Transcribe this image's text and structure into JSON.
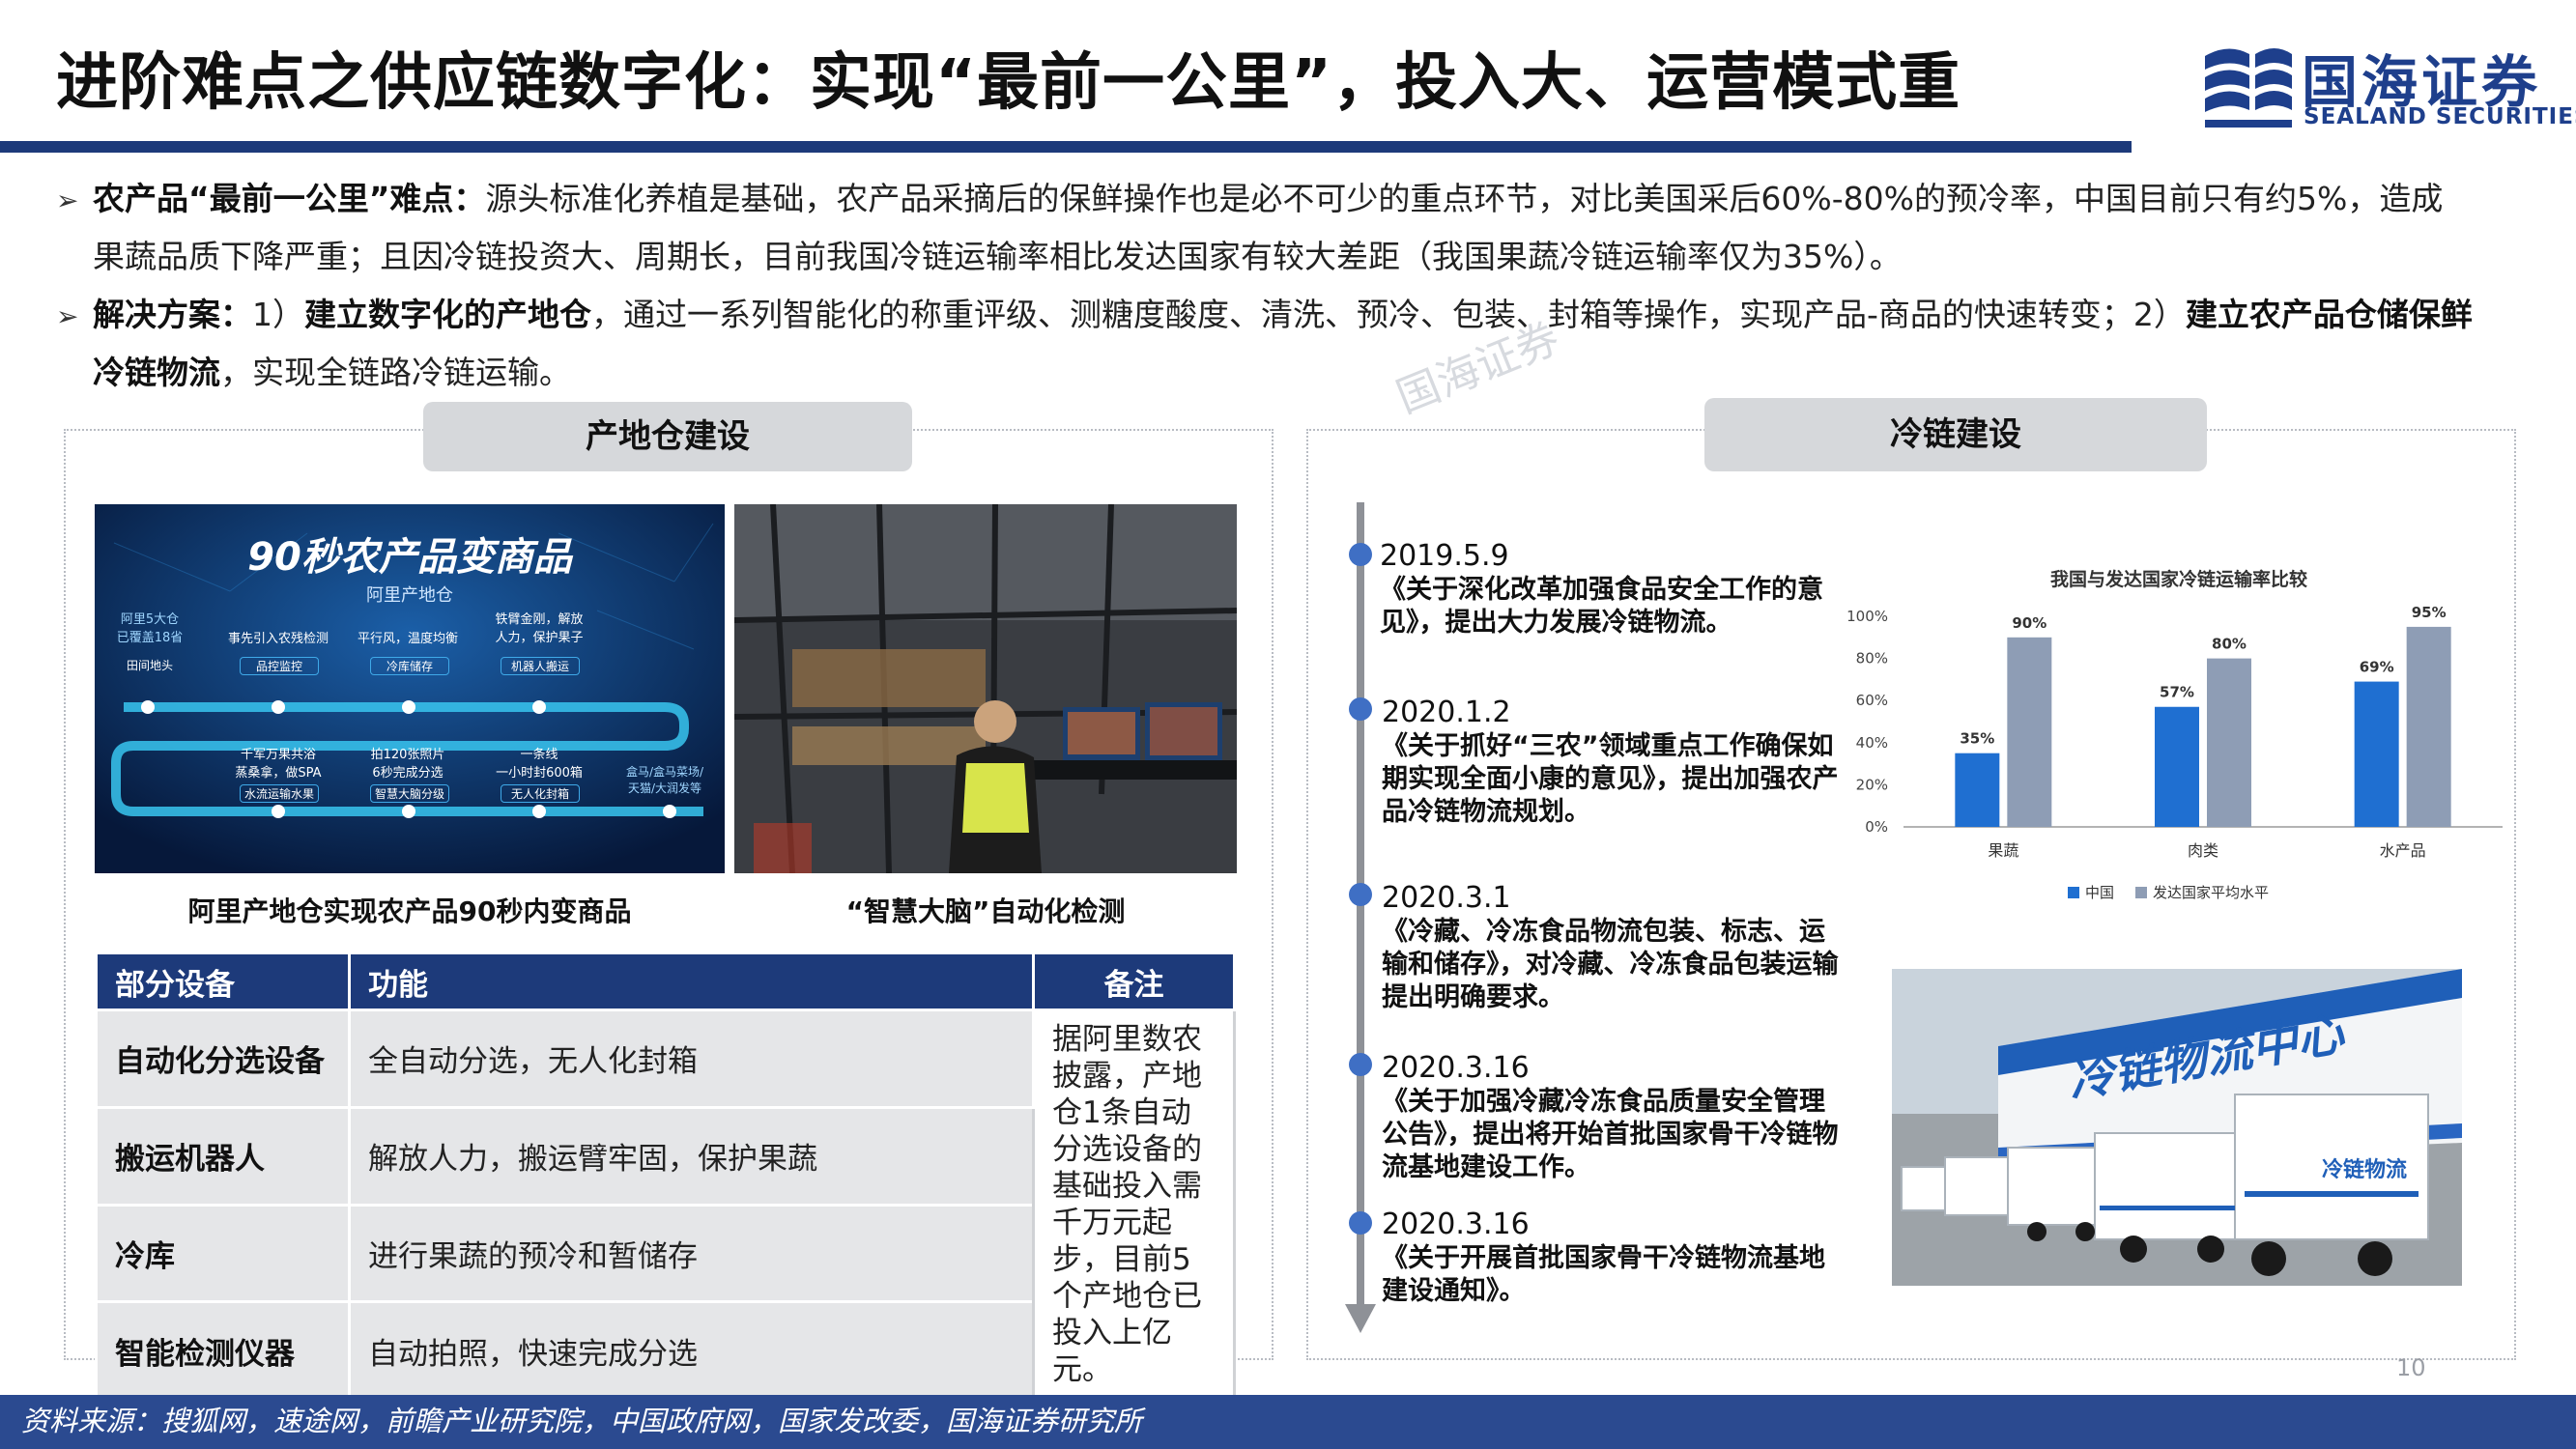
{
  "header": {
    "title": "进阶难点之供应链数字化：实现“最前一公里”，投入大、运营模式重",
    "logo_cn": "国海证券",
    "logo_en": "SEALAND SECURITIES"
  },
  "bullets": [
    {
      "bold": "农产品“最前一公里”难点：",
      "line1": "源头标准化养植是基础，农产品采摘后的保鲜操作也是必不可少的重点环节，对比美国采后60%-80%的预冷率，中国目前只有约5%，造成",
      "line2": "果蔬品质下降严重；且因冷链投资大、周期长，目前我国冷链运输率相比发达国家有较大差距（我国果蔬冷链运输率仅为35%）。"
    },
    {
      "bold": "解决方案：",
      "seg1": "1）",
      "bold2": "建立数字化的产地仓",
      "seg2": "，通过一系列智能化的称重评级、测糖度酸度、清洗、预冷、包装、封箱等操作，实现产品-商品的快速转变；2）",
      "bold3": "建立农产品仓储保鲜",
      "line2_bold": "冷链物流",
      "line2_rest": "，实现全链路冷链运输。"
    }
  ],
  "watermark": "国海证券",
  "left_panel": {
    "tag": "产地仓建设",
    "image1": {
      "headline": "90秒农产品变商品",
      "center_label": "阿里产地仓",
      "nodes_top": [
        "阿里5大仓\n已覆盖18省",
        "事先引入农残检测",
        "平行风，温度均衡",
        "铁臂金刚，解放\n人力，保护果子"
      ],
      "nodes_top_sub": [
        "田间地头",
        "品控监控",
        "冷库储存",
        "机器人搬运"
      ],
      "nodes_bottom": [
        "千军万果共浴\n蒸桑拿，做SPA",
        "拍120张照片\n6秒完成分选",
        "一条线\n一小时封600箱",
        "盒马/盒马菜场/\n天猫/大润发等"
      ],
      "nodes_bottom_sub": [
        "水流运输水果",
        "智慧大脑分级",
        "无人化封箱",
        ""
      ]
    },
    "caption1": "阿里产地仓实现农产品90秒内变商品",
    "caption2": "“智慧大脑”自动化检测",
    "table": {
      "headers": [
        "部分设备",
        "功能",
        "备注"
      ],
      "rows": [
        {
          "name": "自动化分选设备",
          "func": "全自动分选，无人化封箱"
        },
        {
          "name": "搬运机器人",
          "func": "解放人力，搬运臂牢固，保护果蔬"
        },
        {
          "name": "冷库",
          "func": "进行果蔬的预冷和暂储存"
        },
        {
          "name": "智能检测仪器",
          "func": "自动拍照，快速完成分选"
        }
      ],
      "note": "据阿里数农披露，产地仓1条自动分选设备的基础投入需千万元起步，目前5个产地仓已投入上亿元。"
    }
  },
  "right_panel": {
    "tag": "冷链建设",
    "timeline": [
      {
        "date": "2019.5.9",
        "text": "《关于深化改革加强食品安全工作的意见》，提出大力发展冷链物流。"
      },
      {
        "date": "2020.1.2",
        "text": "《关于抓好“三农”领域重点工作确保如期实现全面小康的意见》，提出加强农产品冷链物流规划。"
      },
      {
        "date": "2020.3.1",
        "text": "《冷藏、冷冻食品物流包装、标志、运输和储存》，对冷藏、冷冻食品包装运输提出明确要求。"
      },
      {
        "date": "2020.3.16",
        "text": "《关于加强冷藏冷冻食品质量安全管理公告》，提出将开始首批国家骨干冷链物流基地建设工作。"
      },
      {
        "date": "2020.3.16",
        "text": "《关于开展首批国家骨干冷链物流基地建设通知》。"
      }
    ],
    "photo_sign": "冷链物流中心",
    "truck_sign": "冷链物流"
  },
  "chart_data": {
    "type": "bar",
    "title": "我国与发达国家冷链运输率比较",
    "categories": [
      "果蔬",
      "肉类",
      "水产品"
    ],
    "series": [
      {
        "name": "中国",
        "values": [
          35,
          57,
          69
        ],
        "color": "#1f6fd1"
      },
      {
        "name": "发达国家平均水平",
        "values": [
          90,
          80,
          95
        ],
        "color": "#8e9db5"
      }
    ],
    "y_ticks": [
      "0%",
      "20%",
      "40%",
      "60%",
      "80%",
      "100%"
    ],
    "ylim": [
      0,
      100
    ],
    "value_suffix": "%",
    "legend_position": "bottom",
    "grid": false
  },
  "footer": {
    "source": "资料来源：搜狐网，速途网，前瞻产业研究院，中国政府网，国家发改委，国海证券研究所",
    "page": "10"
  }
}
